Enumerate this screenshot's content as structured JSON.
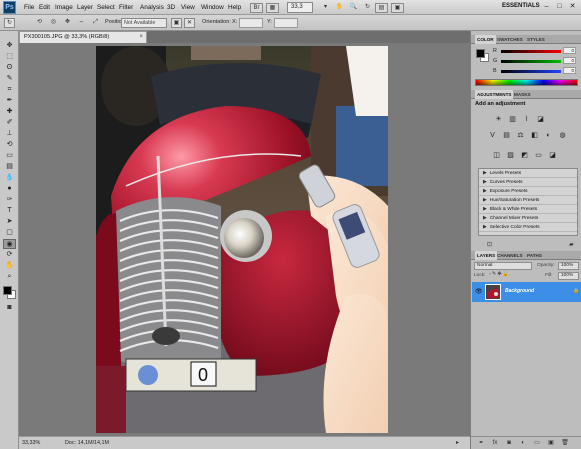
{
  "app": {
    "logo": "Ps",
    "menu": [
      "File",
      "Edit",
      "Image",
      "Layer",
      "Select",
      "Filter",
      "Analysis",
      "3D",
      "View",
      "Window",
      "Help"
    ],
    "zoom": "33,3",
    "workspace": "ESSENTIALS",
    "window_controls": [
      "–",
      "□",
      "✕"
    ]
  },
  "options_bar": {
    "position_label": "Position:",
    "position_value": "Not Available",
    "orientation_label": "Orientation:",
    "x_label": "X:",
    "y_label": "Y:"
  },
  "document": {
    "tab_title": "PX300105.JPG @ 33,3% (RGB/8)",
    "tab_close": "×",
    "status_zoom": "33,33%",
    "status_doc": "Doc: 14,1M/14,1M"
  },
  "color_panel": {
    "tabs": [
      "COLOR",
      "SWATCHES",
      "STYLES"
    ],
    "sliders": [
      {
        "label": "R",
        "value": "0",
        "color": "#d42020"
      },
      {
        "label": "G",
        "value": "0",
        "color": "#1a9a1a"
      },
      {
        "label": "B",
        "value": "0",
        "color": "#1f3fcf"
      }
    ]
  },
  "adjustments_panel": {
    "tabs": [
      "ADJUSTMENTS",
      "MASKS"
    ],
    "title": "Add an adjustment",
    "presets": [
      "Levels Presets",
      "Curves Presets",
      "Exposure Presets",
      "Hue/Saturation Presets",
      "Black & White Presets",
      "Channel Mixer Presets",
      "Selective Color Presets"
    ]
  },
  "layers_panel": {
    "tabs": [
      "LAYERS",
      "CHANNELS",
      "PATHS"
    ],
    "blend_mode": "Normal",
    "opacity_label": "Opacity:",
    "opacity_value": "100%",
    "lock_label": "Lock:",
    "fill_label": "Fill:",
    "fill_value": "100%",
    "layers": [
      {
        "name": "Background",
        "selected": true
      }
    ]
  },
  "colors": {
    "accent": "#3c8ee6",
    "car_red": "#9a1024"
  }
}
